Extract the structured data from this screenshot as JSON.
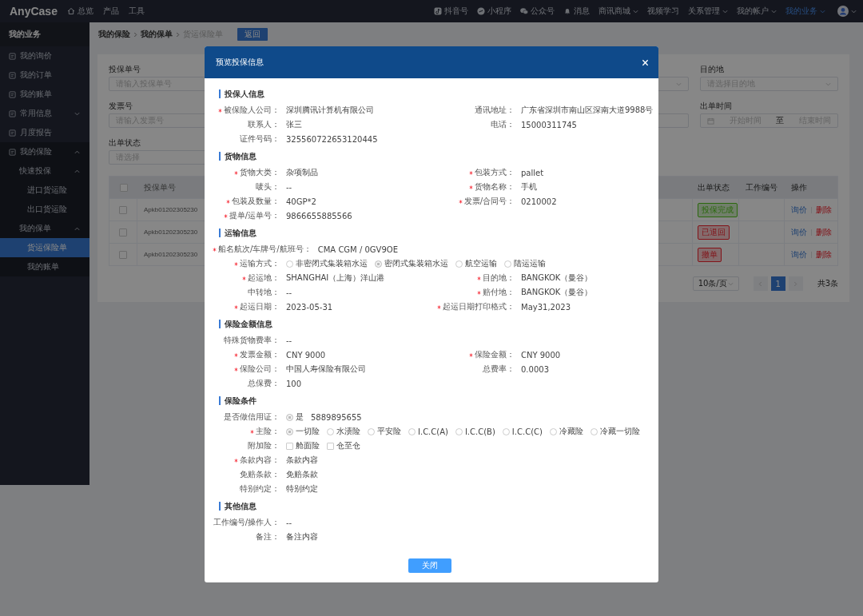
{
  "topbar": {
    "logo": "AnyCase",
    "left_nav": [
      {
        "label": "总览"
      },
      {
        "label": "产品"
      },
      {
        "label": "工具"
      }
    ],
    "right_nav": [
      {
        "label": "抖音号",
        "menu": false,
        "selected": false
      },
      {
        "label": "小程序",
        "menu": false,
        "selected": false
      },
      {
        "label": "公众号",
        "menu": false,
        "selected": false
      },
      {
        "label": "消息",
        "menu": false,
        "selected": false
      },
      {
        "label": "商讯商城",
        "menu": true,
        "selected": false
      },
      {
        "label": "视频学习",
        "menu": false,
        "selected": false
      },
      {
        "label": "关系管理",
        "menu": true,
        "selected": false
      },
      {
        "label": "我的帐户",
        "menu": true,
        "selected": false
      },
      {
        "label": "我的业务",
        "menu": true,
        "selected": true
      }
    ]
  },
  "sidebar": {
    "title": "我的业务",
    "items": [
      {
        "label": "我的询价",
        "selected": false
      },
      {
        "label": "我的订单",
        "selected": false
      },
      {
        "label": "我的账单",
        "selected": false
      },
      {
        "label": "常用信息",
        "selected": false,
        "expanded": false
      },
      {
        "label": "月度报告",
        "selected": false
      },
      {
        "label": "我的保险",
        "selected": false,
        "expanded": true,
        "children": [
          {
            "label": "快速投保",
            "selected": false,
            "expanded": true,
            "children": [
              {
                "label": "进口货运险",
                "selected": false
              },
              {
                "label": "出口货运险",
                "selected": false
              }
            ]
          },
          {
            "label": "我的保单",
            "selected": false,
            "expanded": true,
            "children": [
              {
                "label": "货运保险单",
                "selected": true
              },
              {
                "label": "我的账单",
                "selected": false
              }
            ]
          }
        ]
      }
    ]
  },
  "breadcrumb": [
    "我的保险",
    "我的保单",
    "货运保险单"
  ],
  "back_button": "返回",
  "filters": [
    {
      "label": "投保单号",
      "placeholder": "请输入投保单号"
    },
    {
      "label": "发票号",
      "placeholder": "请输入发票号"
    },
    {
      "label": "出单状态",
      "placeholder": "请选择"
    }
  ],
  "destination": {
    "label": "目的地",
    "placeholder": "请选择目的地"
  },
  "issue_time": {
    "label": "出单时间",
    "start_placeholder": "开始时间",
    "separator": "至",
    "end_placeholder": "结束时间"
  },
  "table": {
    "columns": {
      "policy_no": "投保单号",
      "status": "出单状态",
      "work_no": "工作编号",
      "actions": "操作"
    },
    "select_all": {
      "checked": false
    },
    "rows": [
      {
        "checked": false,
        "policy_no": "Apkb01202305230",
        "status": "投保完成",
        "color": "#2b680e",
        "actions": [
          "询价",
          "删除"
        ]
      },
      {
        "checked": false,
        "policy_no": "Apkb01202305230",
        "status": "已退回",
        "color": "#821218",
        "actions": [
          "询价",
          "删除"
        ]
      },
      {
        "checked": false,
        "policy_no": "Apkb01202305230",
        "status": "撤单",
        "color": "#821218",
        "actions": [
          "询价",
          "删除"
        ]
      }
    ]
  },
  "pagination": {
    "page_size": "10条/页",
    "pages": [
      {
        "label": "1",
        "selected": true
      }
    ],
    "total": "共3条"
  },
  "modal": {
    "title": "预览投保信息",
    "close_button": "关闭",
    "sections": [
      {
        "title": "投保人信息",
        "rows": [
          {
            "fields": [
              {
                "kind": "text",
                "label": "被保险人公司：",
                "required": true,
                "value": "深圳腾讯计算机有限公司"
              },
              {
                "kind": "text",
                "label": "通讯地址：",
                "required": false,
                "value": "广东省深圳市南山区深南大道9988号"
              }
            ]
          },
          {
            "fields": [
              {
                "kind": "text",
                "label": "联系人：",
                "required": false,
                "value": "张三"
              },
              {
                "kind": "text",
                "label": "电话：",
                "required": false,
                "value": "15000311745"
              }
            ]
          },
          {
            "fields": [
              {
                "kind": "text",
                "label": "证件号码：",
                "required": false,
                "value": "325560722653120445"
              }
            ]
          }
        ]
      },
      {
        "title": "货物信息",
        "rows": [
          {
            "fields": [
              {
                "kind": "text",
                "label": "货物大类：",
                "required": true,
                "value": "杂项制品"
              },
              {
                "kind": "text",
                "label": "包装方式：",
                "required": true,
                "value": "pallet"
              }
            ]
          },
          {
            "fields": [
              {
                "kind": "text",
                "label": "唛头：",
                "required": false,
                "value": "--"
              },
              {
                "kind": "text",
                "label": "货物名称：",
                "required": true,
                "value": "手机"
              }
            ]
          },
          {
            "fields": [
              {
                "kind": "text",
                "label": "包装及数量：",
                "required": true,
                "value": "40GP*2"
              },
              {
                "kind": "text",
                "label": "发票/合同号：",
                "required": true,
                "value": "0210002"
              }
            ]
          },
          {
            "fields": [
              {
                "kind": "text",
                "label": "提单/运单号：",
                "required": true,
                "value": "9866655885566"
              }
            ]
          }
        ]
      },
      {
        "title": "运输信息",
        "rows": [
          {
            "fields": [
              {
                "kind": "text",
                "label": "船名航次/车牌号/航班号：",
                "required": true,
                "value": "CMA CGM / 0GV9OE"
              }
            ]
          },
          {
            "fields": [
              {
                "kind": "radio",
                "label": "运输方式：",
                "required": true,
                "options": [
                  {
                    "label": "非密闭式集装箱水运",
                    "selected": false
                  },
                  {
                    "label": "密闭式集装箱水运",
                    "selected": true
                  },
                  {
                    "label": "航空运输",
                    "selected": false
                  },
                  {
                    "label": "陆运运输",
                    "selected": false
                  }
                ]
              }
            ]
          },
          {
            "fields": [
              {
                "kind": "text",
                "label": "起运地：",
                "required": true,
                "value": "SHANGHAI（上海）洋山港"
              },
              {
                "kind": "text",
                "label": "目的地：",
                "required": true,
                "value": "BANGKOK（曼谷）"
              }
            ]
          },
          {
            "fields": [
              {
                "kind": "text",
                "label": "中转地：",
                "required": false,
                "value": "--"
              },
              {
                "kind": "text",
                "label": "赔付地：",
                "required": true,
                "value": "BANGKOK（曼谷）"
              }
            ]
          },
          {
            "fields": [
              {
                "kind": "text",
                "label": "起运日期：",
                "required": true,
                "value": "2023-05-31"
              },
              {
                "kind": "text",
                "label": "起运日期打印格式：",
                "required": true,
                "value": "May31,2023"
              }
            ]
          }
        ]
      },
      {
        "title": "保险金额信息",
        "rows": [
          {
            "fields": [
              {
                "kind": "text",
                "label": "特殊货物费率：",
                "required": false,
                "value": "--"
              }
            ]
          },
          {
            "fields": [
              {
                "kind": "text",
                "label": "发票金额：",
                "required": true,
                "value": "CNY 9000"
              },
              {
                "kind": "text",
                "label": "保险金额：",
                "required": true,
                "value": "CNY 9000"
              }
            ]
          },
          {
            "fields": [
              {
                "kind": "text",
                "label": "保险公司：",
                "required": true,
                "value": "中国人寿保险有限公司"
              },
              {
                "kind": "text",
                "label": "总费率：",
                "required": false,
                "value": "0.0003"
              }
            ]
          },
          {
            "fields": [
              {
                "kind": "text",
                "label": "总保费：",
                "required": false,
                "value": "100"
              }
            ]
          }
        ]
      },
      {
        "title": "保险条件",
        "rows": [
          {
            "fields": [
              {
                "kind": "radio",
                "label": "是否做信用证：",
                "required": false,
                "options": [
                  {
                    "label": "是",
                    "selected": true
                  }
                ],
                "value": "5889895655"
              }
            ]
          },
          {
            "fields": [
              {
                "kind": "radio",
                "label": "主险：",
                "required": true,
                "options": [
                  {
                    "label": "一切险",
                    "selected": true
                  },
                  {
                    "label": "水渍险",
                    "selected": false
                  },
                  {
                    "label": "平安险",
                    "selected": false
                  },
                  {
                    "label": "I.C.C(A)",
                    "selected": false
                  },
                  {
                    "label": "I.C.C(B)",
                    "selected": false
                  },
                  {
                    "label": "I.C.C(C)",
                    "selected": false
                  },
                  {
                    "label": "冷藏险",
                    "selected": false
                  },
                  {
                    "label": "冷藏一切险",
                    "selected": false
                  }
                ]
              }
            ]
          },
          {
            "fields": [
              {
                "kind": "checkbox",
                "label": "附加险：",
                "required": false,
                "options": [
                  {
                    "label": "舱面险",
                    "checked": false
                  },
                  {
                    "label": "仓至仓",
                    "checked": false
                  }
                ]
              }
            ]
          },
          {
            "fields": [
              {
                "kind": "text",
                "label": "条款内容：",
                "required": true,
                "value": "条款内容"
              }
            ]
          },
          {
            "fields": [
              {
                "kind": "text",
                "label": "免赔条款：",
                "required": false,
                "value": "免赔条款"
              }
            ]
          },
          {
            "fields": [
              {
                "kind": "text",
                "label": "特别约定：",
                "required": false,
                "value": "特别约定"
              }
            ]
          }
        ]
      },
      {
        "title": "其他信息",
        "rows": [
          {
            "fields": [
              {
                "kind": "text",
                "label": "工作编号/操作人：",
                "required": false,
                "value": "--"
              }
            ]
          },
          {
            "fields": [
              {
                "kind": "text",
                "label": "备注：",
                "required": false,
                "value": "备注内容"
              }
            ]
          }
        ]
      }
    ]
  }
}
